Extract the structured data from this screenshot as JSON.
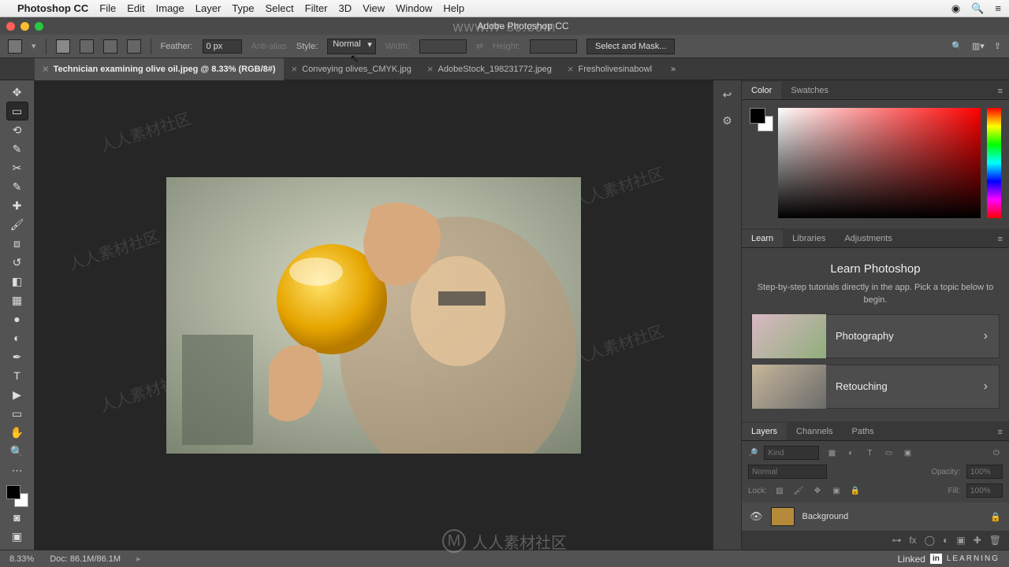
{
  "mac_menu": {
    "app": "Photoshop CC",
    "items": [
      "File",
      "Edit",
      "Image",
      "Layer",
      "Type",
      "Select",
      "Filter",
      "3D",
      "View",
      "Window",
      "Help"
    ]
  },
  "window": {
    "title": "Adobe Photoshop CC"
  },
  "options": {
    "feather_label": "Feather:",
    "feather_value": "0 px",
    "antialias": "Anti-alias",
    "style_label": "Style:",
    "style_value": "Normal",
    "width_label": "Width:",
    "height_label": "Height:",
    "mask_btn": "Select and Mask..."
  },
  "tabs": [
    {
      "label": "Technician examining olive oil.jpeg @ 8.33% (RGB/8#)",
      "active": true
    },
    {
      "label": "Conveying olives_CMYK.jpg",
      "active": false
    },
    {
      "label": "AdobeStock_198231772.jpeg",
      "active": false
    },
    {
      "label": "Fresholivesinabowl",
      "active": false
    }
  ],
  "panels": {
    "color_tabs": [
      "Color",
      "Swatches"
    ],
    "learn_tabs": [
      "Learn",
      "Libraries",
      "Adjustments"
    ],
    "learn_title": "Learn Photoshop",
    "learn_sub": "Step-by-step tutorials directly in the app. Pick a topic below to begin.",
    "learn_cards": [
      "Photography",
      "Retouching"
    ],
    "layer_tabs": [
      "Layers",
      "Channels",
      "Paths"
    ],
    "layer_filter": "Kind",
    "blend_mode": "Normal",
    "opacity_label": "Opacity:",
    "opacity_value": "100%",
    "lock_label": "Lock:",
    "fill_label": "Fill:",
    "fill_value": "100%",
    "layer_name": "Background"
  },
  "status": {
    "zoom": "8.33%",
    "doc": "Doc: 86.1M/86.1M",
    "brand_a": "Linked",
    "brand_b": "in",
    "brand_c": "LEARNING"
  },
  "watermark_url": "www.rr-sc.com",
  "watermark_cn": "人人素材社区"
}
